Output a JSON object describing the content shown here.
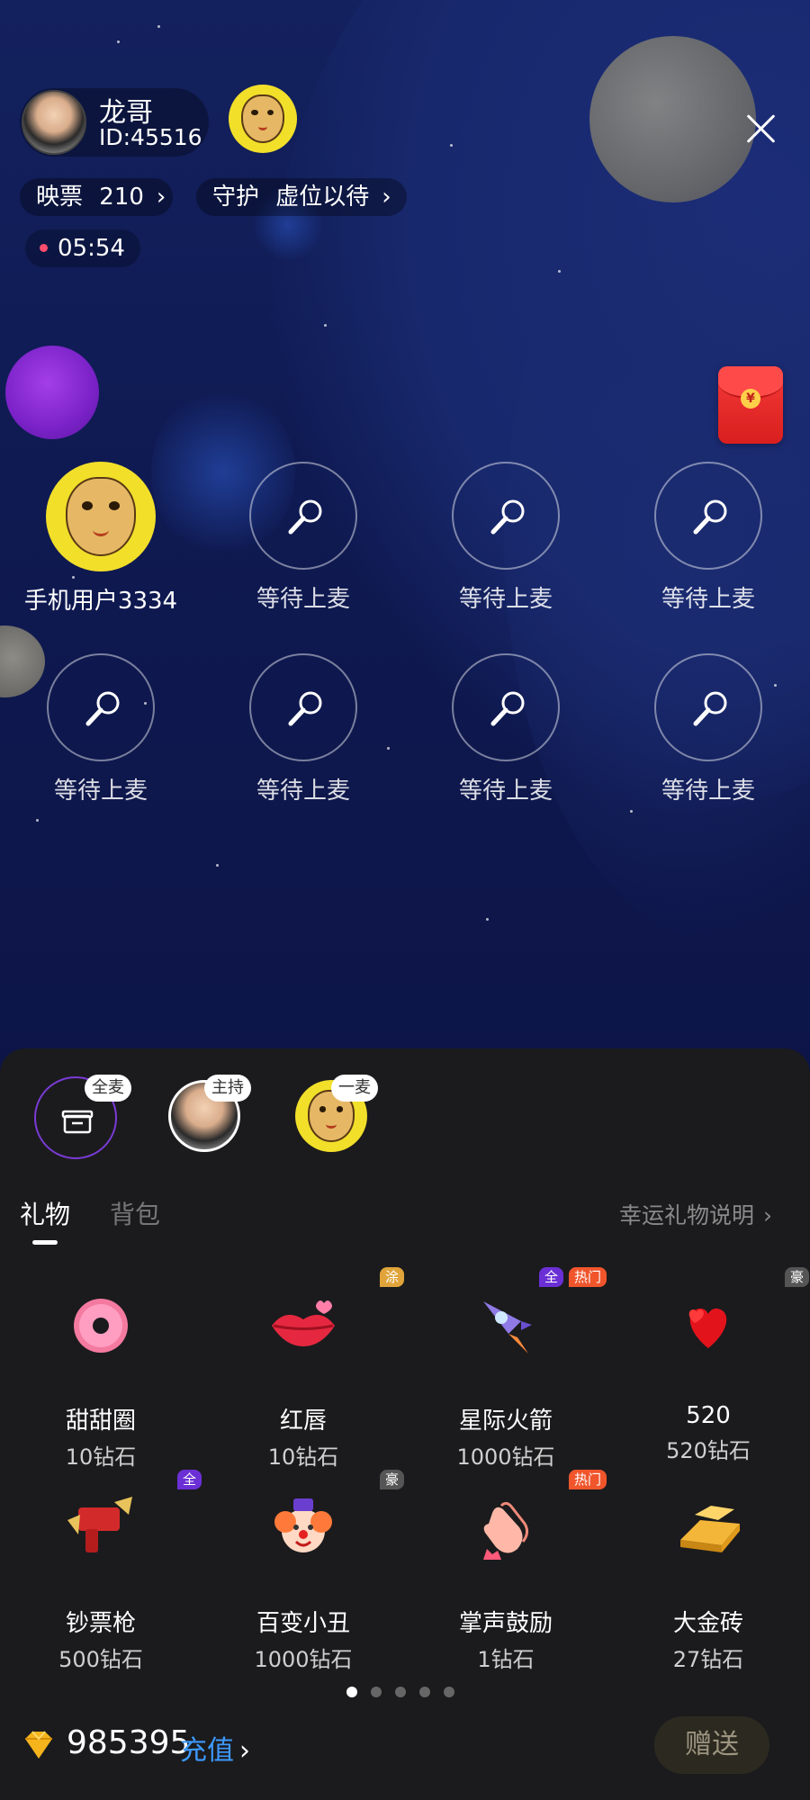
{
  "header": {
    "host_name": "龙哥",
    "host_id": "ID:45516",
    "tickets_label": "映票",
    "tickets_value": "210",
    "guard_label": "守护",
    "guard_value": "虚位以待",
    "timer": "05:54"
  },
  "seats": [
    {
      "label": "手机用户3334",
      "occupied": true
    },
    {
      "label": "等待上麦",
      "occupied": false
    },
    {
      "label": "等待上麦",
      "occupied": false
    },
    {
      "label": "等待上麦",
      "occupied": false
    },
    {
      "label": "等待上麦",
      "occupied": false
    },
    {
      "label": "等待上麦",
      "occupied": false
    },
    {
      "label": "等待上麦",
      "occupied": false
    },
    {
      "label": "等待上麦",
      "occupied": false
    }
  ],
  "targets": [
    {
      "badge": "全麦",
      "icon": "gift-box-icon"
    },
    {
      "badge": "主持",
      "icon": "host-avatar"
    },
    {
      "badge": "一麦",
      "icon": "leopard-avatar"
    }
  ],
  "tabs": {
    "gift": "礼物",
    "backpack": "背包",
    "lucky_link": "幸运礼物说明"
  },
  "gifts": [
    {
      "name": "甜甜圈",
      "price": "10钻石",
      "icon": "donut-icon",
      "tags": []
    },
    {
      "name": "红唇",
      "price": "10钻石",
      "icon": "lips-icon",
      "tags": [
        {
          "text": "涂",
          "color": "#e0a43a"
        }
      ]
    },
    {
      "name": "星际火箭",
      "price": "1000钻石",
      "icon": "rocket-icon",
      "tags": [
        {
          "text": "全",
          "color": "#6b2fd6"
        },
        {
          "text": "热门",
          "color": "#f0552c"
        }
      ]
    },
    {
      "name": "520",
      "price": "520钻石",
      "icon": "hearts-icon",
      "tags": [
        {
          "text": "豪",
          "color": "#555555"
        }
      ]
    },
    {
      "name": "钞票枪",
      "price": "500钻石",
      "icon": "money-gun-icon",
      "tags": [
        {
          "text": "全",
          "color": "#6b2fd6"
        }
      ]
    },
    {
      "name": "百变小丑",
      "price": "1000钻石",
      "icon": "clown-icon",
      "tags": [
        {
          "text": "豪",
          "color": "#555555"
        }
      ]
    },
    {
      "name": "掌声鼓励",
      "price": "1钻石",
      "icon": "clap-icon",
      "tags": [
        {
          "text": "热门",
          "color": "#f0552c"
        }
      ]
    },
    {
      "name": "大金砖",
      "price": "27钻石",
      "icon": "gold-bar-icon",
      "tags": []
    }
  ],
  "pager": {
    "count": 5,
    "active": 0
  },
  "footer": {
    "balance": "985395",
    "recharge": "充值",
    "send": "赠送"
  }
}
